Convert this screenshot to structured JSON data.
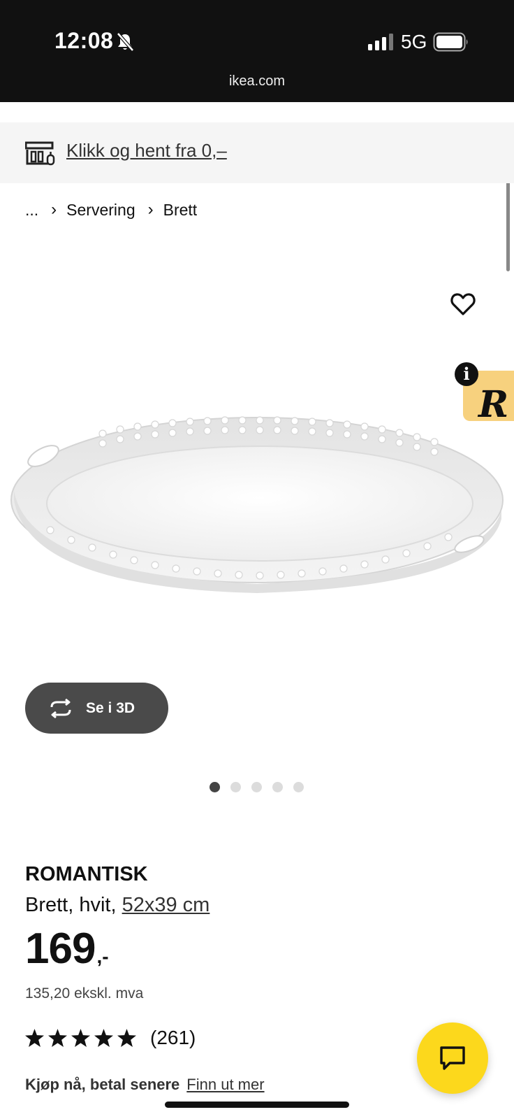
{
  "status_bar": {
    "time": "12:08",
    "network": "5G",
    "url": "ikea.com"
  },
  "promo": {
    "link_text": "Klikk og hent fra 0,–"
  },
  "breadcrumb": {
    "ellipsis": "...",
    "items": [
      "Servering",
      "Brett"
    ]
  },
  "gallery": {
    "view_3d_label": "Se i 3D",
    "badge_letter": "R",
    "badge_info": "i",
    "total_images": 5,
    "active_index": 0
  },
  "product": {
    "brand": "ROMANTISK",
    "description": "Brett, hvit,",
    "size": "52x39 cm",
    "price_integer": "169",
    "price_suffix": ",-",
    "price_ex_vat": "135,20 ekskl. mva",
    "rating_stars": 5,
    "rating_count": "(261)"
  },
  "payment": {
    "label": "Kjøp nå, betal senere",
    "link": "Finn ut mer"
  },
  "colors": {
    "status_bar_bg": "#111111",
    "promo_bg": "#f5f5f5",
    "button_3d_bg": "#4a4a4a",
    "chat_button_bg": "#fcd81c",
    "badge_bg": "#f7d17e"
  }
}
